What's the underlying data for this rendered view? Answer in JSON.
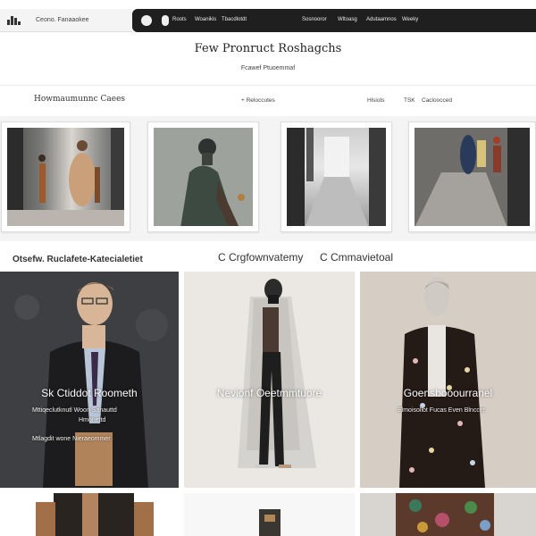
{
  "topbar": {
    "brand": "Ceono. Fanaaokee",
    "nav_left": [
      "Roots",
      "Woanikis",
      "Tbacdlotdt"
    ],
    "nav_right": [
      "Sosnooror",
      "Wltoasg",
      "Adutaamnos",
      "Weeky"
    ]
  },
  "header": {
    "title": "Few Pronruct Roshagchs",
    "subtitle": "Fcawef Ptuoemmaf"
  },
  "filters": {
    "label": "Howmaumunnc Caees",
    "links": [
      "+ Reloccutes",
      "Hlsiots",
      "TSK",
      "Cacloocced"
    ]
  },
  "section": {
    "left": "Otsefw. Ruclafete-Katecialetiet",
    "center": "C Crgfownvatemy",
    "right": "C Cmmavietoal"
  },
  "cards": [
    {
      "title": "Sk Ctiddot   Roometh",
      "line1": "Mttiqeclutknutl  Woon Sanauttd",
      "line2": "Hmonettd",
      "line3": "Mtlagdit   wone  Nieraeommer"
    },
    {
      "title": "Nevionf Oeetmmtuore"
    },
    {
      "title": "Goensbooourranel",
      "line1": "Elmoisollot  Fucas Even  Blnccet"
    }
  ],
  "colors": {
    "nav_dark": "#1f1f1f",
    "strip_bg": "#f4f4f4",
    "card1_bg": "#3f4144",
    "card2_bg": "#ebe8e4",
    "card3_bg": "#d8cfc6"
  }
}
